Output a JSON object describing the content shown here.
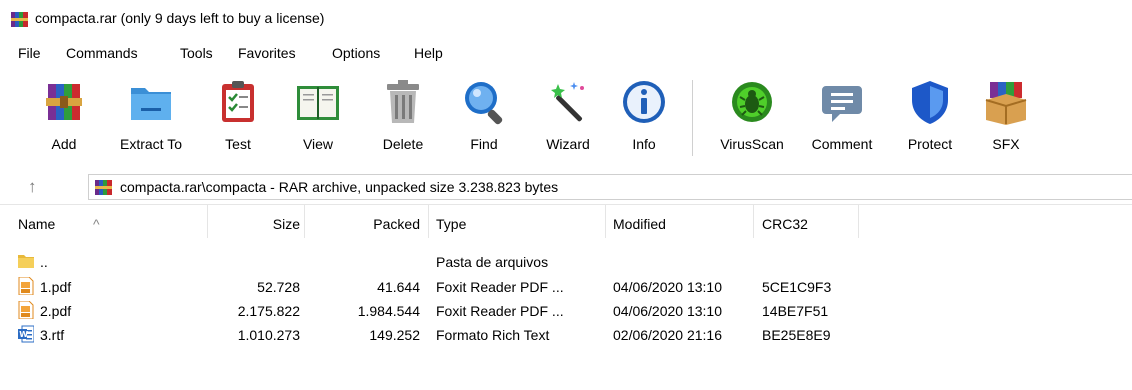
{
  "window": {
    "title": "compacta.rar (only 9 days left to buy a license)"
  },
  "menu": [
    "File",
    "Commands",
    "Tools",
    "Favorites",
    "Options",
    "Help"
  ],
  "toolbar": [
    {
      "label": "Add",
      "icon": "add-archive-icon"
    },
    {
      "label": "Extract To",
      "icon": "extract-folder-icon"
    },
    {
      "label": "Test",
      "icon": "test-clipboard-icon"
    },
    {
      "label": "View",
      "icon": "view-book-icon"
    },
    {
      "label": "Delete",
      "icon": "trash-can-icon"
    },
    {
      "label": "Find",
      "icon": "magnifier-icon"
    },
    {
      "label": "Wizard",
      "icon": "magic-wand-icon"
    },
    {
      "label": "Info",
      "icon": "info-icon"
    },
    {
      "label": "VirusScan",
      "icon": "virus-scan-icon"
    },
    {
      "label": "Comment",
      "icon": "comment-bubble-icon"
    },
    {
      "label": "Protect",
      "icon": "shield-icon"
    },
    {
      "label": "SFX",
      "icon": "sfx-box-icon"
    }
  ],
  "address": {
    "path": "compacta.rar\\compacta - RAR archive, unpacked size 3.238.823 bytes"
  },
  "columns": {
    "name": "Name",
    "size": "Size",
    "packed": "Packed",
    "type": "Type",
    "modified": "Modified",
    "crc": "CRC32"
  },
  "files": [
    {
      "name": "..",
      "size": "",
      "packed": "",
      "type": "Pasta de arquivos",
      "modified": "",
      "crc": "",
      "icon": "folder-icon"
    },
    {
      "name": "1.pdf",
      "size": "52.728",
      "packed": "41.644",
      "type": "Foxit Reader PDF ...",
      "modified": "04/06/2020 13:10",
      "crc": "5CE1C9F3",
      "icon": "pdf-file-icon"
    },
    {
      "name": "2.pdf",
      "size": "2.175.822",
      "packed": "1.984.544",
      "type": "Foxit Reader PDF ...",
      "modified": "04/06/2020 13:10",
      "crc": "14BE7F51",
      "icon": "pdf-file-icon"
    },
    {
      "name": "3.rtf",
      "size": "1.010.273",
      "packed": "149.252",
      "type": "Formato Rich Text",
      "modified": "02/06/2020 21:16",
      "crc": "BE25E8E9",
      "icon": "word-file-icon"
    }
  ]
}
